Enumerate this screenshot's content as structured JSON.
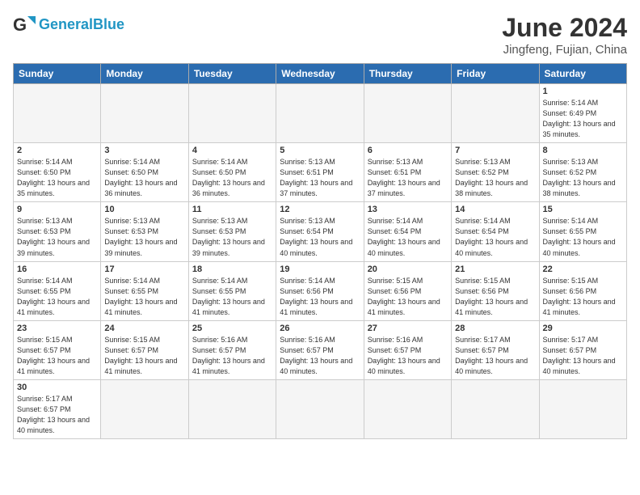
{
  "header": {
    "logo_general": "General",
    "logo_blue": "Blue",
    "month_title": "June 2024",
    "location": "Jingfeng, Fujian, China"
  },
  "weekdays": [
    "Sunday",
    "Monday",
    "Tuesday",
    "Wednesday",
    "Thursday",
    "Friday",
    "Saturday"
  ],
  "days": [
    {
      "num": "",
      "empty": true,
      "sunrise": "",
      "sunset": "",
      "daylight": ""
    },
    {
      "num": "",
      "empty": true,
      "sunrise": "",
      "sunset": "",
      "daylight": ""
    },
    {
      "num": "",
      "empty": true,
      "sunrise": "",
      "sunset": "",
      "daylight": ""
    },
    {
      "num": "",
      "empty": true,
      "sunrise": "",
      "sunset": "",
      "daylight": ""
    },
    {
      "num": "",
      "empty": true,
      "sunrise": "",
      "sunset": "",
      "daylight": ""
    },
    {
      "num": "",
      "empty": true,
      "sunrise": "",
      "sunset": "",
      "daylight": ""
    },
    {
      "num": "1",
      "empty": false,
      "sunrise": "5:14 AM",
      "sunset": "6:49 PM",
      "daylight": "13 hours and 35 minutes."
    },
    {
      "num": "2",
      "empty": false,
      "sunrise": "5:14 AM",
      "sunset": "6:50 PM",
      "daylight": "13 hours and 35 minutes."
    },
    {
      "num": "3",
      "empty": false,
      "sunrise": "5:14 AM",
      "sunset": "6:50 PM",
      "daylight": "13 hours and 36 minutes."
    },
    {
      "num": "4",
      "empty": false,
      "sunrise": "5:14 AM",
      "sunset": "6:50 PM",
      "daylight": "13 hours and 36 minutes."
    },
    {
      "num": "5",
      "empty": false,
      "sunrise": "5:13 AM",
      "sunset": "6:51 PM",
      "daylight": "13 hours and 37 minutes."
    },
    {
      "num": "6",
      "empty": false,
      "sunrise": "5:13 AM",
      "sunset": "6:51 PM",
      "daylight": "13 hours and 37 minutes."
    },
    {
      "num": "7",
      "empty": false,
      "sunrise": "5:13 AM",
      "sunset": "6:52 PM",
      "daylight": "13 hours and 38 minutes."
    },
    {
      "num": "8",
      "empty": false,
      "sunrise": "5:13 AM",
      "sunset": "6:52 PM",
      "daylight": "13 hours and 38 minutes."
    },
    {
      "num": "9",
      "empty": false,
      "sunrise": "5:13 AM",
      "sunset": "6:53 PM",
      "daylight": "13 hours and 39 minutes."
    },
    {
      "num": "10",
      "empty": false,
      "sunrise": "5:13 AM",
      "sunset": "6:53 PM",
      "daylight": "13 hours and 39 minutes."
    },
    {
      "num": "11",
      "empty": false,
      "sunrise": "5:13 AM",
      "sunset": "6:53 PM",
      "daylight": "13 hours and 39 minutes."
    },
    {
      "num": "12",
      "empty": false,
      "sunrise": "5:13 AM",
      "sunset": "6:54 PM",
      "daylight": "13 hours and 40 minutes."
    },
    {
      "num": "13",
      "empty": false,
      "sunrise": "5:14 AM",
      "sunset": "6:54 PM",
      "daylight": "13 hours and 40 minutes."
    },
    {
      "num": "14",
      "empty": false,
      "sunrise": "5:14 AM",
      "sunset": "6:54 PM",
      "daylight": "13 hours and 40 minutes."
    },
    {
      "num": "15",
      "empty": false,
      "sunrise": "5:14 AM",
      "sunset": "6:55 PM",
      "daylight": "13 hours and 40 minutes."
    },
    {
      "num": "16",
      "empty": false,
      "sunrise": "5:14 AM",
      "sunset": "6:55 PM",
      "daylight": "13 hours and 41 minutes."
    },
    {
      "num": "17",
      "empty": false,
      "sunrise": "5:14 AM",
      "sunset": "6:55 PM",
      "daylight": "13 hours and 41 minutes."
    },
    {
      "num": "18",
      "empty": false,
      "sunrise": "5:14 AM",
      "sunset": "6:55 PM",
      "daylight": "13 hours and 41 minutes."
    },
    {
      "num": "19",
      "empty": false,
      "sunrise": "5:14 AM",
      "sunset": "6:56 PM",
      "daylight": "13 hours and 41 minutes."
    },
    {
      "num": "20",
      "empty": false,
      "sunrise": "5:15 AM",
      "sunset": "6:56 PM",
      "daylight": "13 hours and 41 minutes."
    },
    {
      "num": "21",
      "empty": false,
      "sunrise": "5:15 AM",
      "sunset": "6:56 PM",
      "daylight": "13 hours and 41 minutes."
    },
    {
      "num": "22",
      "empty": false,
      "sunrise": "5:15 AM",
      "sunset": "6:56 PM",
      "daylight": "13 hours and 41 minutes."
    },
    {
      "num": "23",
      "empty": false,
      "sunrise": "5:15 AM",
      "sunset": "6:57 PM",
      "daylight": "13 hours and 41 minutes."
    },
    {
      "num": "24",
      "empty": false,
      "sunrise": "5:15 AM",
      "sunset": "6:57 PM",
      "daylight": "13 hours and 41 minutes."
    },
    {
      "num": "25",
      "empty": false,
      "sunrise": "5:16 AM",
      "sunset": "6:57 PM",
      "daylight": "13 hours and 41 minutes."
    },
    {
      "num": "26",
      "empty": false,
      "sunrise": "5:16 AM",
      "sunset": "6:57 PM",
      "daylight": "13 hours and 40 minutes."
    },
    {
      "num": "27",
      "empty": false,
      "sunrise": "5:16 AM",
      "sunset": "6:57 PM",
      "daylight": "13 hours and 40 minutes."
    },
    {
      "num": "28",
      "empty": false,
      "sunrise": "5:17 AM",
      "sunset": "6:57 PM",
      "daylight": "13 hours and 40 minutes."
    },
    {
      "num": "29",
      "empty": false,
      "sunrise": "5:17 AM",
      "sunset": "6:57 PM",
      "daylight": "13 hours and 40 minutes."
    },
    {
      "num": "30",
      "empty": false,
      "sunrise": "5:17 AM",
      "sunset": "6:57 PM",
      "daylight": "13 hours and 40 minutes."
    },
    {
      "num": "",
      "empty": true
    },
    {
      "num": "",
      "empty": true
    },
    {
      "num": "",
      "empty": true
    },
    {
      "num": "",
      "empty": true
    },
    {
      "num": "",
      "empty": true
    },
    {
      "num": "",
      "empty": true
    }
  ],
  "labels": {
    "sunrise_prefix": "Sunrise: ",
    "sunset_prefix": "Sunset: ",
    "daylight_prefix": "Daylight: "
  }
}
